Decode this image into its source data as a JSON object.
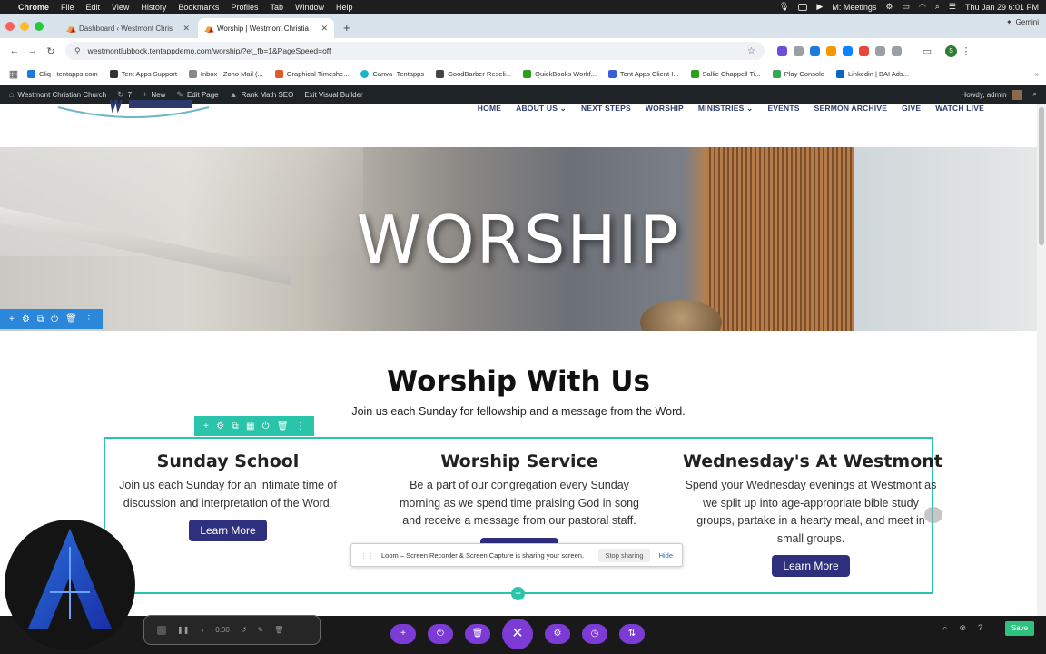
{
  "menubar": {
    "app": "Chrome",
    "items": [
      "File",
      "Edit",
      "View",
      "History",
      "Bookmarks",
      "Profiles",
      "Tab",
      "Window",
      "Help"
    ],
    "meetings": "M: Meetings",
    "datetime": "Thu Jan 29  6:01 PM"
  },
  "tabs": [
    {
      "title": "Dashboard ‹ Westmont Chris"
    },
    {
      "title": "Worship | Westmont Christia"
    }
  ],
  "gemini": "Gemini",
  "address": {
    "url": "westmontlubbock.tentappdemo.com/worship/?et_fb=1&PageSpeed=off"
  },
  "bookmarks": [
    {
      "label": "Cliq - tentapps.com",
      "color": "#1f7ae0"
    },
    {
      "label": "Tent Apps Support",
      "color": "#333333"
    },
    {
      "label": "Inbox - Zoho Mail (...",
      "color": "#888888"
    },
    {
      "label": "Graphical Timeshe...",
      "color": "#e05a2a"
    },
    {
      "label": "Canva- Tentapps",
      "color": "#19b3c9"
    },
    {
      "label": "GoodBarber Reseli...",
      "color": "#444444"
    },
    {
      "label": "QuickBooks Workf...",
      "color": "#2ca01c"
    },
    {
      "label": "Tent Apps Client I...",
      "color": "#3b5fd6"
    },
    {
      "label": "Sallie Chappell Ti...",
      "color": "#2ca01c"
    },
    {
      "label": "Play Console",
      "color": "#34a853"
    },
    {
      "label": "Linkedin | BAI Ads...",
      "color": "#0a66c2"
    }
  ],
  "adminbar": {
    "site": "Westmont Christian Church",
    "updates": "7",
    "new": "New",
    "edit": "Edit Page",
    "seo": "Rank Math SEO",
    "exit": "Exit Visual Builder",
    "howdy": "Howdy, admin"
  },
  "nav": [
    "HOME",
    "ABOUT US ⌄",
    "NEXT STEPS",
    "WORSHIP",
    "MINISTRIES ⌄",
    "EVENTS",
    "SERMON ARCHIVE",
    "GIVE",
    "WATCH LIVE"
  ],
  "hero": {
    "title": "WORSHIP"
  },
  "section": {
    "title": "Worship With Us",
    "subtitle": "Join us each Sunday for fellowship and a message from the Word."
  },
  "columns": [
    {
      "title": "Sunday School",
      "text": "Join us each Sunday for an intimate time of discussion and interpretation of the Word.",
      "button": "Learn More"
    },
    {
      "title": "Worship Service",
      "text": "Be a part of our congregation every Sunday morning as we spend time praising God in song and receive a message from our pastoral staff.",
      "button": "Learn More"
    },
    {
      "title": "Wednesday's At Westmont",
      "text": "Spend your Wednesday evenings at Westmont as we split up into age-appropriate bible study groups, partake in a hearty meal, and meet in small groups.",
      "button": "Learn More"
    }
  ],
  "loom": {
    "message": "Loom – Screen Recorder & Screen Capture is sharing your screen.",
    "stop": "Stop sharing",
    "hide": "Hide"
  },
  "recorder": {
    "time": "0:00"
  },
  "builder": {
    "save": "Save"
  },
  "colors": {
    "accent": "#29c4a9",
    "builder_purple": "#7d3bd6",
    "button": "#2e2f7d",
    "nav": "#2d3a6b"
  }
}
